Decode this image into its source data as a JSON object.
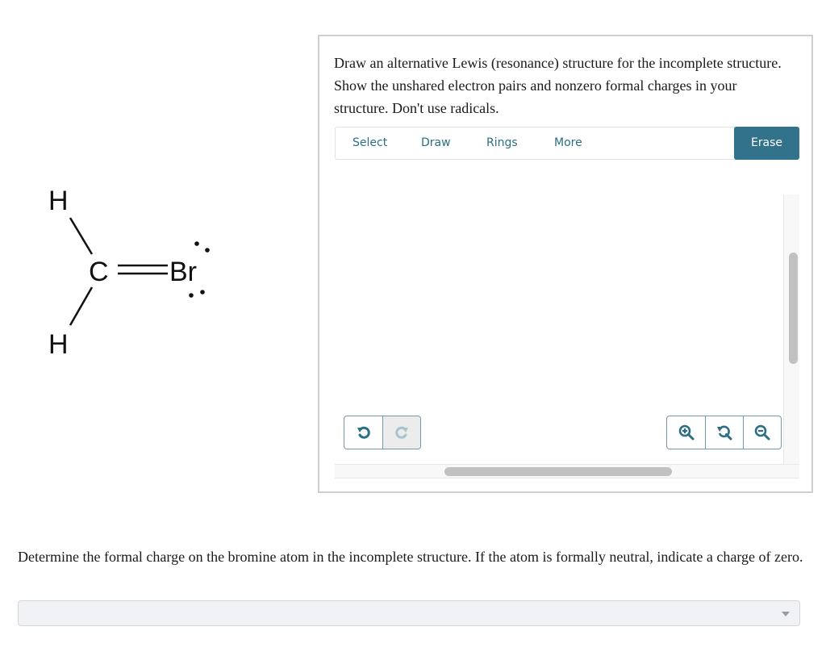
{
  "molecule": {
    "atoms": {
      "carbon": "C",
      "bromine": "Br",
      "hydrogen_top": "H",
      "hydrogen_bottom": "H"
    },
    "bonds": [
      {
        "from": "H",
        "to": "C",
        "order": 1
      },
      {
        "from": "H",
        "to": "C",
        "order": 1
      },
      {
        "from": "C",
        "to": "Br",
        "order": 2
      }
    ],
    "bromine_lone_pairs": 2
  },
  "editor": {
    "prompt": "Draw an alternative Lewis (resonance) structure for the incomplete structure. Show the unshared electron pairs and nonzero formal charges in your structure. Don't use radicals.",
    "toolbar": {
      "tabs": [
        "Select",
        "Draw",
        "Rings",
        "More"
      ],
      "erase_label": "Erase"
    },
    "undo_redo": {
      "undo_icon": "undo-icon",
      "redo_icon": "redo-icon",
      "redo_enabled": false
    },
    "zoom_controls": [
      "zoom-in-icon",
      "reset-zoom-icon",
      "zoom-out-icon"
    ],
    "accent_color": "#32728a"
  },
  "question2": {
    "text": "Determine the formal charge on the bromine atom in the incomplete structure. If the atom is formally neutral, indicate a charge of zero.",
    "select_value": ""
  }
}
